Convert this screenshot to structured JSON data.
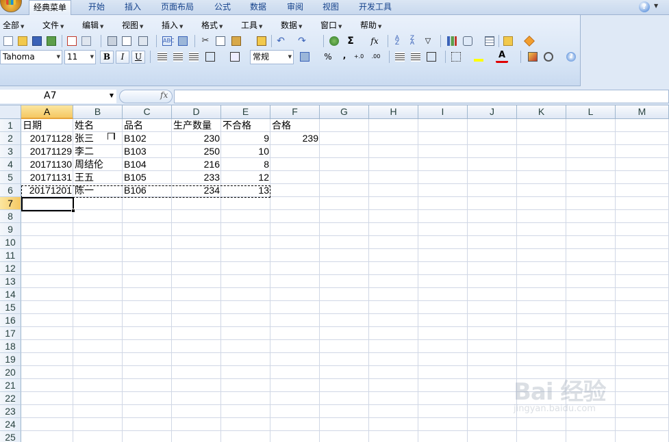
{
  "ribbon_tabs": [
    "经典菜单",
    "开始",
    "插入",
    "页面布局",
    "公式",
    "数据",
    "审阅",
    "视图",
    "开发工具"
  ],
  "classic_menu": [
    "全部",
    "文件",
    "编辑",
    "视图",
    "插入",
    "格式",
    "工具",
    "数据",
    "窗口",
    "帮助"
  ],
  "format_toolbar": {
    "font_name": "Tahoma",
    "font_size": "11",
    "bold": "B",
    "italic": "I",
    "underline": "U",
    "number_format": "常规",
    "percent": "%",
    "comma": ",",
    "increase_decimal": "+.0",
    "decrease_decimal": ".00"
  },
  "formula_bar": {
    "name_box": "A7",
    "fx": "fx",
    "content": ""
  },
  "columns": [
    "A",
    "B",
    "C",
    "D",
    "E",
    "F",
    "G",
    "H",
    "I",
    "J",
    "K",
    "L",
    "M"
  ],
  "rows": [
    "1",
    "2",
    "3",
    "4",
    "5",
    "6",
    "7",
    "8",
    "9",
    "10",
    "11",
    "12",
    "13",
    "14",
    "15",
    "16",
    "17",
    "18",
    "19",
    "20",
    "21",
    "22",
    "23",
    "24",
    "25"
  ],
  "cells": {
    "A1": "日期",
    "B1": "姓名",
    "C1": "品名",
    "D1": "生产数量",
    "E1": "不合格",
    "F1": "合格",
    "A2": "20171128",
    "B2": "张三",
    "C2": "B102",
    "D2": "230",
    "E2": "9",
    "F2": "239",
    "A3": "20171129",
    "B3": "李二",
    "C3": "B103",
    "D3": "250",
    "E3": "10",
    "A4": "20171130",
    "B4": "周结伦",
    "C4": "B104",
    "D4": "216",
    "E4": "8",
    "A5": "20171131",
    "B5": "王五",
    "C5": "B105",
    "D5": "233",
    "E5": "12",
    "A6": "20171201",
    "B6": "陈一",
    "C6": "B106",
    "D6": "234",
    "E6": "13"
  },
  "selection": {
    "active_cell": "A7",
    "copy_range": "A6:E6"
  },
  "watermark": {
    "brand": "Bai 经验",
    "url": "jingyan.baidu.com"
  },
  "colors": {
    "accent": "#15428b",
    "selected_header": "#f5c862",
    "grid_line": "#d0d7e5"
  }
}
